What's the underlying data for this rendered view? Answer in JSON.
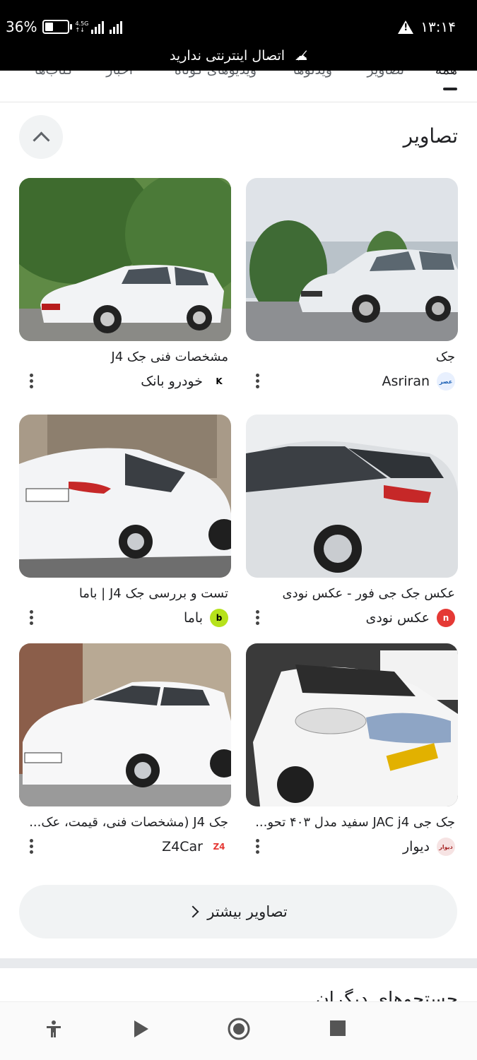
{
  "status_bar": {
    "battery_text": "36%",
    "battery_level": 0.36,
    "network": "4.5G",
    "time": "۱۳:۱۴",
    "offline_message": "اتصال اینترنتی ندارید"
  },
  "tabs": [
    "همه",
    "تصاویر",
    "ویدئوها",
    "ویدیوهای کوتاه",
    "اخبار",
    "کتاب‌ها"
  ],
  "section": {
    "title": "تصاویر",
    "more_label": "تصاویر بیشتر",
    "next_peek": "جستجوهای دیگران"
  },
  "results": [
    {
      "caption": "جک",
      "source": "Asriran",
      "favicon_text": "عصر",
      "favicon_color": "#1a5fb4",
      "favicon_bg": "#e8f0fe"
    },
    {
      "caption": "مشخصات فنی جک J4",
      "source": "خودرو بانک",
      "favicon_text": "K",
      "favicon_color": "#000000",
      "favicon_bg": "#ffffff"
    },
    {
      "caption": "عکس جک جی فور - عکس نودی",
      "source": "عکس نودی",
      "favicon_text": "n",
      "favicon_color": "#ffffff",
      "favicon_bg": "#e53935"
    },
    {
      "caption": "تست و بررسی جک J4 | باما",
      "source": "باما",
      "favicon_text": "b",
      "favicon_color": "#000000",
      "favicon_bg": "#b6e21b"
    },
    {
      "caption": "جک جی JAC j4 سفید مدل ۴۰۳ تحو...",
      "source": "دیوار",
      "favicon_text": "دیوار",
      "favicon_color": "#a62626",
      "favicon_bg": "#f6e3e3"
    },
    {
      "caption": "جک J4 (مشخصات فنی، قیمت، عک...",
      "source": "Z4Car",
      "favicon_text": "Z4",
      "favicon_color": "#e53935",
      "favicon_bg": "#ffffff"
    }
  ],
  "colors": {
    "accent": "#202124",
    "chip_bg": "#f1f3f4"
  },
  "navbar": {
    "icons": [
      "accessibility-icon",
      "play-icon",
      "record-icon",
      "stop-icon"
    ]
  }
}
